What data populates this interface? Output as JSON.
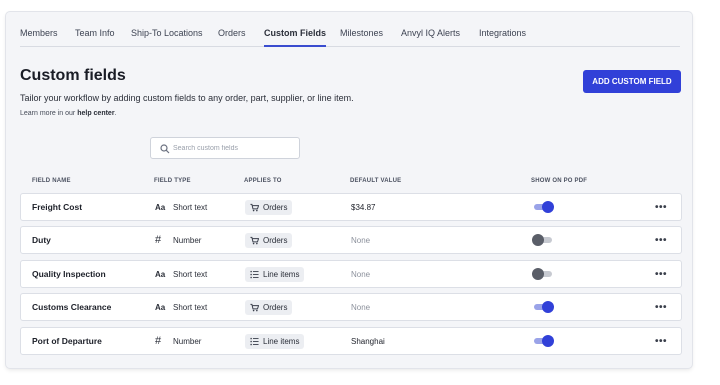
{
  "tabs": [
    {
      "label": "Members"
    },
    {
      "label": "Team Info"
    },
    {
      "label": "Ship-To Locations"
    },
    {
      "label": "Orders"
    },
    {
      "label": "Custom Fields",
      "active": true
    },
    {
      "label": "Milestones"
    },
    {
      "label": "Anvyl IQ Alerts"
    },
    {
      "label": "Integrations"
    }
  ],
  "page": {
    "title": "Custom fields",
    "subtitle": "Tailor your workflow by adding custom fields to any order, part, supplier, or line item.",
    "help_prefix": "Learn more in our ",
    "help_link": "help center",
    "help_suffix": ".",
    "add_button": "ADD CUSTOM FIELD"
  },
  "search": {
    "placeholder": "Search custom fields",
    "value": "",
    "icon": "search-icon"
  },
  "table": {
    "headers": {
      "name": "FIELD NAME",
      "type": "FIELD TYPE",
      "applies": "APPLIES TO",
      "default": "DEFAULT VALUE",
      "pdf": "SHOW ON PO PDF"
    },
    "rows": [
      {
        "name": "Freight Cost",
        "type_icon": "Aa",
        "type": "Short text",
        "applies_icon": "cart-icon",
        "applies": "Orders",
        "default": "$34.87",
        "default_is_none": false,
        "show_on_pdf": true,
        "more": "•••"
      },
      {
        "name": "Duty",
        "type_icon": "#",
        "type": "Number",
        "applies_icon": "cart-icon",
        "applies": "Orders",
        "default": "None",
        "default_is_none": true,
        "show_on_pdf": false,
        "more": "•••"
      },
      {
        "name": "Quality Inspection",
        "type_icon": "Aa",
        "type": "Short text",
        "applies_icon": "list-icon",
        "applies": "Line items",
        "default": "None",
        "default_is_none": true,
        "show_on_pdf": false,
        "more": "•••"
      },
      {
        "name": "Customs Clearance",
        "type_icon": "Aa",
        "type": "Short text",
        "applies_icon": "cart-icon",
        "applies": "Orders",
        "default": "None",
        "default_is_none": true,
        "show_on_pdf": true,
        "more": "•••"
      },
      {
        "name": "Port of Departure",
        "type_icon": "#",
        "type": "Number",
        "applies_icon": "list-icon",
        "applies": "Line items",
        "default": "Shanghai",
        "default_is_none": false,
        "show_on_pdf": true,
        "more": "•••"
      }
    ]
  },
  "colors": {
    "accent": "#3140d8",
    "toggle_off": "#5a5e68",
    "background": "#f4f5f8"
  }
}
